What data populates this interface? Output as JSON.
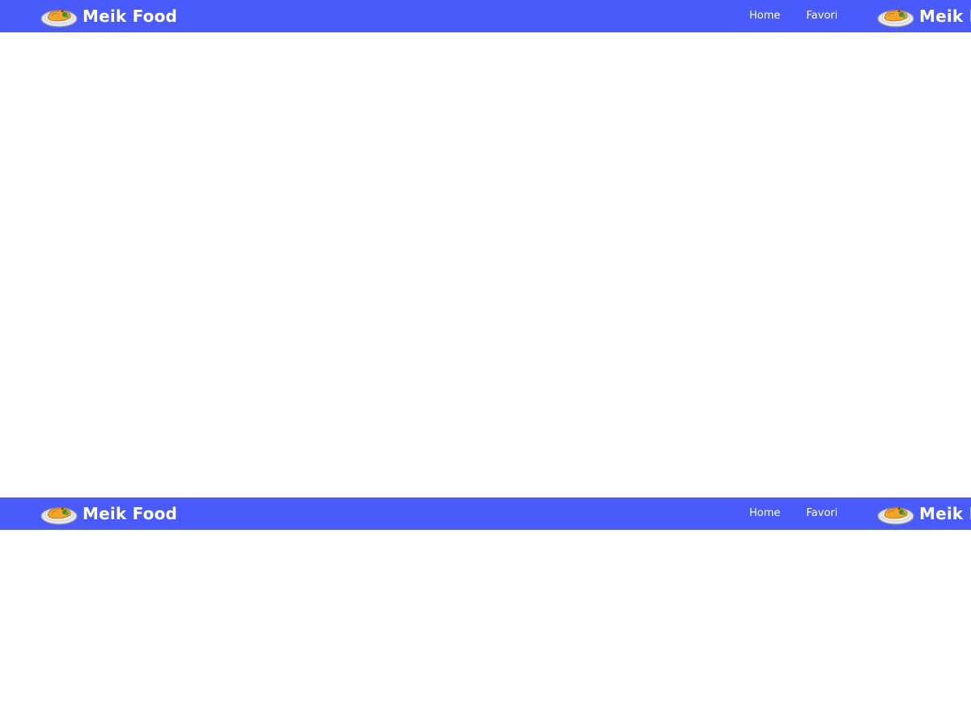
{
  "navbar": {
    "brand_name": "Meik Food",
    "links": [
      {
        "label": "Home"
      },
      {
        "label": "Favori"
      }
    ],
    "background_color": "#4a5bfc",
    "logo_icon": "food-plate-icon"
  },
  "navbar_repeat": {
    "brand_name": "Meik Food",
    "links": [
      {
        "label": "Home"
      },
      {
        "label": "Favori"
      }
    ]
  }
}
